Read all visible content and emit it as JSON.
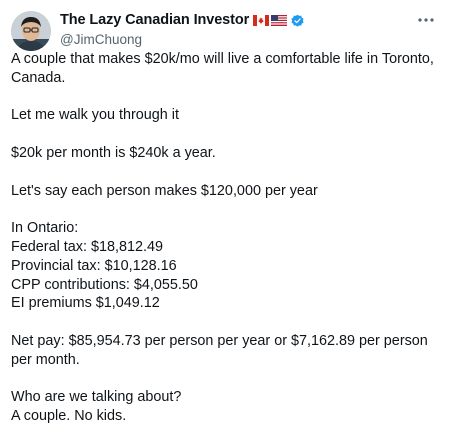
{
  "author": {
    "display_name": "The Lazy Canadian Investor",
    "handle": "@JimChuong",
    "flags": [
      "canada-flag-icon",
      "usa-flag-icon"
    ],
    "verified": "verified-badge-icon"
  },
  "more_icon": "more-horizontal-icon",
  "colors": {
    "text": "#0f1419",
    "secondary": "#536471",
    "verified": "#1d9bf0"
  },
  "tweet": {
    "line1": "A couple that makes $20k/mo will live a comfortable life in Toronto, Canada.",
    "line2": "Let me walk you through it",
    "line3": "$20k per month is $240k a year.",
    "line4": "Let's say each person makes $120,000 per year",
    "ontario_heading": "In Ontario:",
    "federal_tax": "Federal tax: $18,812.49",
    "provincial_tax": "Provincial tax: $10,128.16",
    "cpp": "CPP contributions: $4,055.50",
    "ei": "EI premiums $1,049.12",
    "net_pay": "Net pay: $85,954.73 per person per year or $7,162.89 per person per month.",
    "question": "Who are we talking about?",
    "answer": "A couple. No kids."
  }
}
